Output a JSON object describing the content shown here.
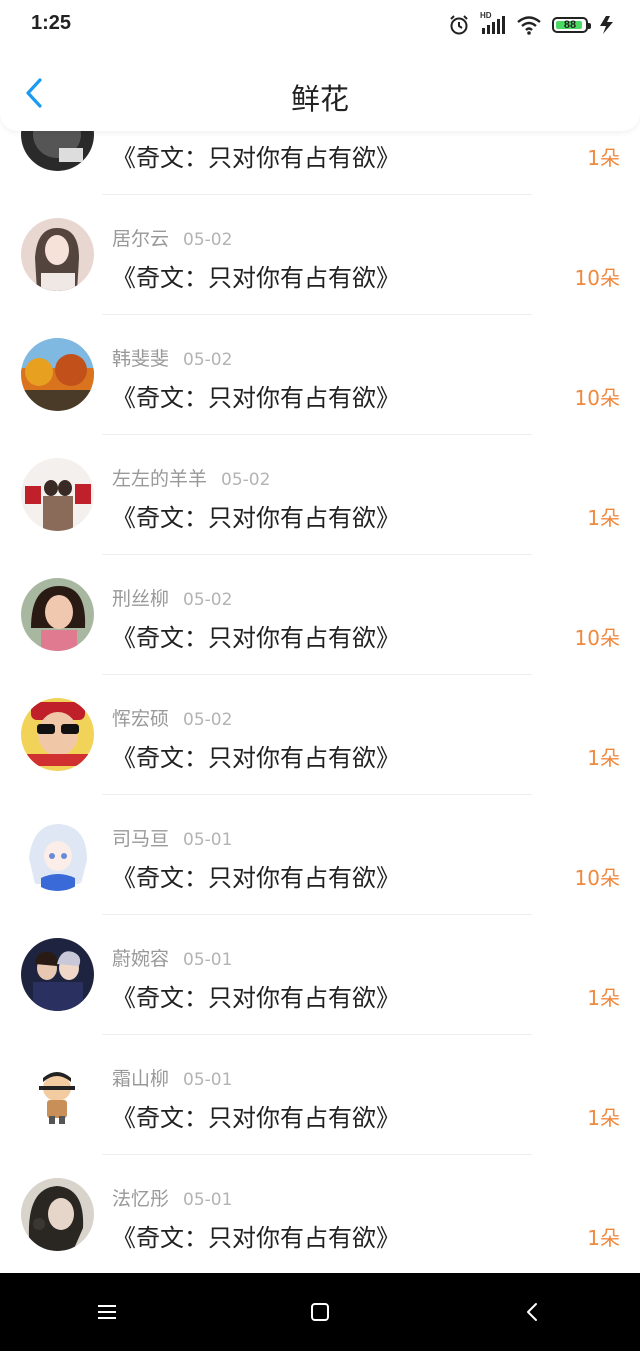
{
  "status": {
    "time": "1:25",
    "battery": "88",
    "network": "HD"
  },
  "header": {
    "title": "鲜花"
  },
  "colors": {
    "accent": "#1a9af2",
    "count": "#f0883e",
    "battery_green": "#4cd964"
  },
  "items": [
    {
      "name": "",
      "date": "",
      "title": "《奇文：只对你有占有欲》",
      "count": "1朵",
      "avatar": "dark-photo"
    },
    {
      "name": "居尔云",
      "date": "05-02",
      "title": "《奇文：只对你有占有欲》",
      "count": "10朵",
      "avatar": "girl-photo"
    },
    {
      "name": "韩斐斐",
      "date": "05-02",
      "title": "《奇文：只对你有占有欲》",
      "count": "10朵",
      "avatar": "autumn-landscape"
    },
    {
      "name": "左左的羊羊",
      "date": "05-02",
      "title": "《奇文：只对你有占有欲》",
      "count": "1朵",
      "avatar": "red-text-poster"
    },
    {
      "name": "刑丝柳",
      "date": "05-02",
      "title": "《奇文：只对你有占有欲》",
      "count": "10朵",
      "avatar": "woman-photo"
    },
    {
      "name": "恽宏硕",
      "date": "05-02",
      "title": "《奇文：只对你有占有欲》",
      "count": "1朵",
      "avatar": "sunglasses-man"
    },
    {
      "name": "司马亘",
      "date": "05-01",
      "title": "《奇文：只对你有占有欲》",
      "count": "10朵",
      "avatar": "anime-girl"
    },
    {
      "name": "蔚婉容",
      "date": "05-01",
      "title": "《奇文：只对你有占有欲》",
      "count": "1朵",
      "avatar": "couple-photo"
    },
    {
      "name": "霜山柳",
      "date": "05-01",
      "title": "《奇文：只对你有占有欲》",
      "count": "1朵",
      "avatar": "cartoon-boy"
    },
    {
      "name": "法忆彤",
      "date": "05-01",
      "title": "《奇文：只对你有占有欲》",
      "count": "1朵",
      "avatar": "girl-bw-photo"
    }
  ]
}
